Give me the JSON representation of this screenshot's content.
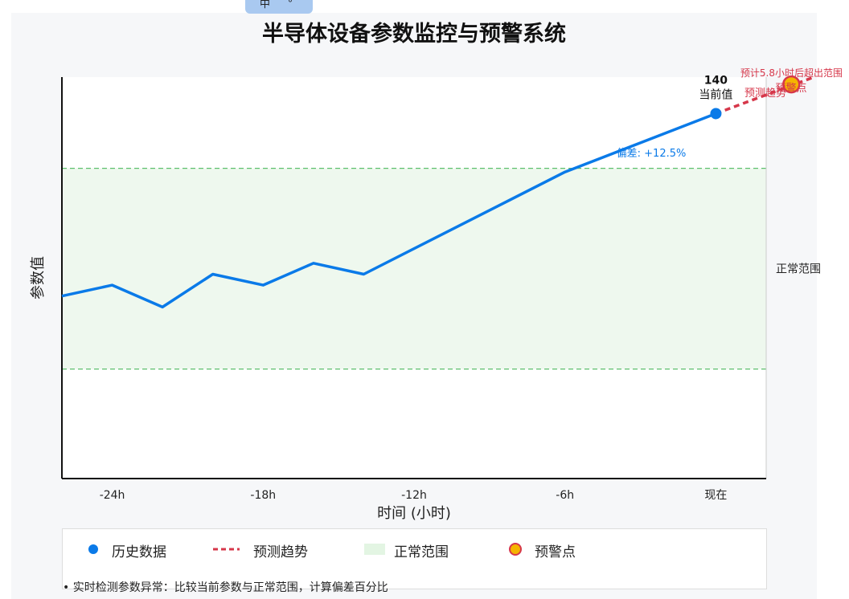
{
  "language_toggle": {
    "label": "中",
    "symbol": "°"
  },
  "title": "半导体设备参数监控与预警系统",
  "chart_data": {
    "type": "line",
    "title": "半导体设备参数监控与预警系统",
    "xlabel": "时间 (小时)",
    "ylabel": "参数值",
    "x_ticks": [
      "-24h",
      "-18h",
      "-12h",
      "-6h",
      "现在"
    ],
    "xlim": [
      -26,
      2
    ],
    "ylim": [
      40,
      150
    ],
    "historical": {
      "name": "历史数据",
      "color": "#0a7ae8",
      "x": [
        -26,
        -24,
        -22,
        -20,
        -18,
        -16,
        -14,
        -6,
        0
      ],
      "y": [
        90,
        93,
        87,
        96,
        93,
        99,
        96,
        124,
        140
      ]
    },
    "forecast": {
      "name": "预测趋势",
      "color": "#d6374a",
      "x": [
        0,
        3.9
      ],
      "y": [
        140,
        150
      ]
    },
    "normal_range": {
      "name": "正常范围",
      "lower": 70,
      "upper": 125,
      "label": "正常范围"
    },
    "warning_point": {
      "name": "预警点",
      "x": 3,
      "y": 148,
      "label": "预警点",
      "note": "预计5.8小时后超出范围"
    },
    "current_point": {
      "x": 0,
      "y": 140,
      "value_label": "140",
      "label": "当前值"
    },
    "annotations": {
      "deviation": "偏差: +12.5%",
      "forecast_label": "预测趋势"
    }
  },
  "legend": {
    "items": [
      {
        "label": "历史数据",
        "marker": "dot",
        "color": "#0a7ae8"
      },
      {
        "label": "预测趋势",
        "marker": "dashed-line",
        "color": "#d6374a"
      },
      {
        "label": "正常范围",
        "marker": "band",
        "color": "#e3f5e3"
      },
      {
        "label": "预警点",
        "marker": "warning-dot",
        "color": "#f5b400"
      }
    ]
  },
  "note": "• 实时检测参数异常：比较当前参数与正常范围，计算偏差百分比"
}
